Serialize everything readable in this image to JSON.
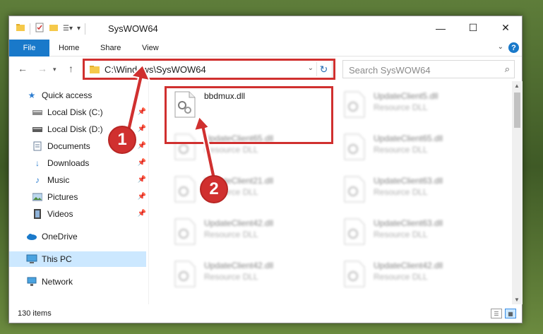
{
  "window": {
    "title": "SysWOW64",
    "controls": {
      "minimize": "—",
      "maximize": "☐",
      "close": "✕"
    }
  },
  "ribbon": {
    "tabs": [
      {
        "label": "File"
      },
      {
        "label": "Home"
      },
      {
        "label": "Share"
      },
      {
        "label": "View"
      }
    ],
    "help": "?"
  },
  "navigation": {
    "address_path": "C:\\Windows\\SysWOW64",
    "search_placeholder": "Search SysWOW64"
  },
  "sidebar": {
    "items": [
      {
        "label": "Quick access",
        "icon": "star-icon"
      },
      {
        "label": "Local Disk (C:)",
        "icon": "drive-icon",
        "pinned": true
      },
      {
        "label": "Local Disk (D:)",
        "icon": "drive-icon",
        "pinned": true
      },
      {
        "label": "Documents",
        "icon": "documents-icon",
        "pinned": true
      },
      {
        "label": "Downloads",
        "icon": "downloads-icon",
        "pinned": true
      },
      {
        "label": "Music",
        "icon": "music-icon",
        "pinned": true
      },
      {
        "label": "Pictures",
        "icon": "pictures-icon",
        "pinned": true
      },
      {
        "label": "Videos",
        "icon": "videos-icon",
        "pinned": true
      },
      {
        "label": "OneDrive",
        "icon": "cloud-icon"
      },
      {
        "label": "This PC",
        "icon": "computer-icon",
        "selected": true
      },
      {
        "label": "Network",
        "icon": "network-icon"
      }
    ]
  },
  "files": {
    "highlighted": {
      "name": "bbdmux.dll",
      "description": ""
    },
    "blurred": [
      {
        "name": "UpdateClient5.dll",
        "description": "Resource DLL"
      },
      {
        "name": "UpdateClient65.dll",
        "description": "Resource DLL"
      },
      {
        "name": "UpdateClient65.dll",
        "description": "Resource DLL"
      },
      {
        "name": "UpdateClient21.dll",
        "description": "Resource DLL"
      },
      {
        "name": "UpdateClient63.dll",
        "description": "Resource DLL"
      },
      {
        "name": "UpdateClient42.dll",
        "description": "Resource DLL"
      },
      {
        "name": "UpdateClient63.dll",
        "description": "Resource DLL"
      },
      {
        "name": "UpdateClient42.dll",
        "description": "Resource DLL"
      },
      {
        "name": "UpdateClient42.dll",
        "description": "Resource DLL"
      }
    ]
  },
  "status": {
    "item_count": "130 items"
  },
  "callouts": {
    "one": "1",
    "two": "2"
  },
  "colors": {
    "accent": "#1979ca",
    "highlight": "#d0302f",
    "selected": "#cce8ff"
  }
}
